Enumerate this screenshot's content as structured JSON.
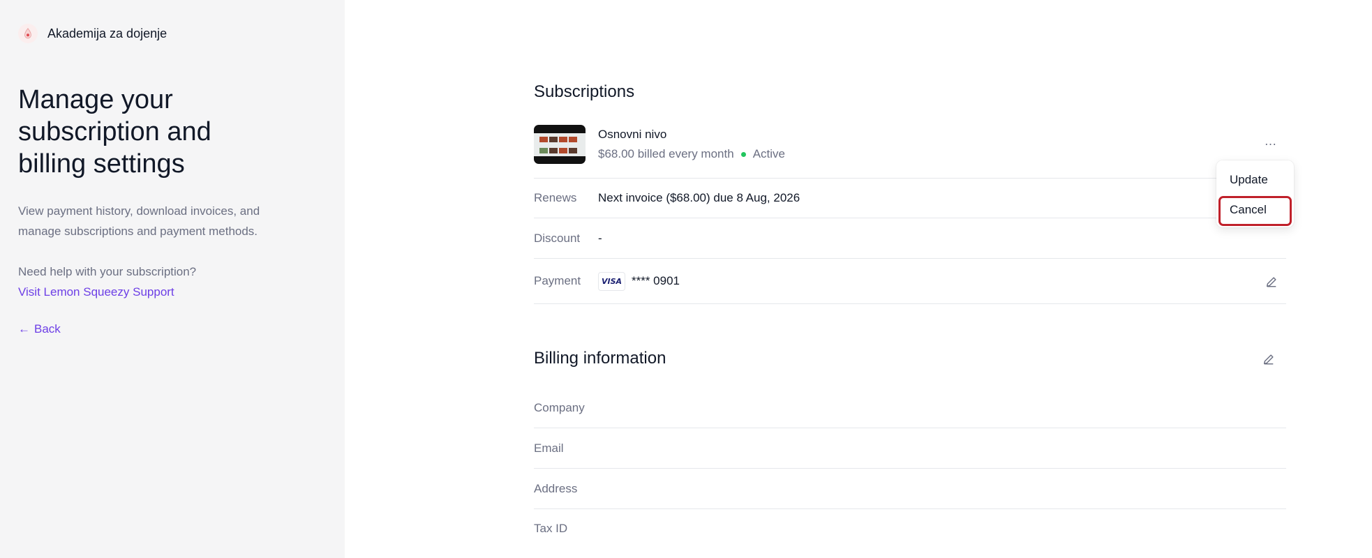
{
  "sidebar": {
    "brand_name": "Akademija za dojenje",
    "title": "Manage your subscription and billing settings",
    "intro": "View payment history, download invoices, and manage subscriptions and payment methods.",
    "help_text": "Need help with your subscription?",
    "support_link": "Visit Lemon Squeezy Support",
    "back_label": "Back",
    "back_arrow": "←",
    "accent_color": "#6d3fe6"
  },
  "subscriptions": {
    "title": "Subscriptions",
    "plan_name": "Osnovni nivo",
    "billing": "$68.00 billed every month",
    "status": "Active",
    "status_color": "#22c55e",
    "more_icon": "…",
    "renews_label": "Renews",
    "renews_value": "Next invoice ($68.00) due 8 Aug, 2026",
    "discount_label": "Discount",
    "discount_value": "-",
    "payment_label": "Payment",
    "card_brand": "VISA",
    "card_number": "**** 0901"
  },
  "menu": {
    "update": "Update",
    "cancel": "Cancel",
    "highlight_color": "#c0202a"
  },
  "billing": {
    "title": "Billing information",
    "company_label": "Company",
    "email_label": "Email",
    "address_label": "Address",
    "tax_label": "Tax ID"
  }
}
